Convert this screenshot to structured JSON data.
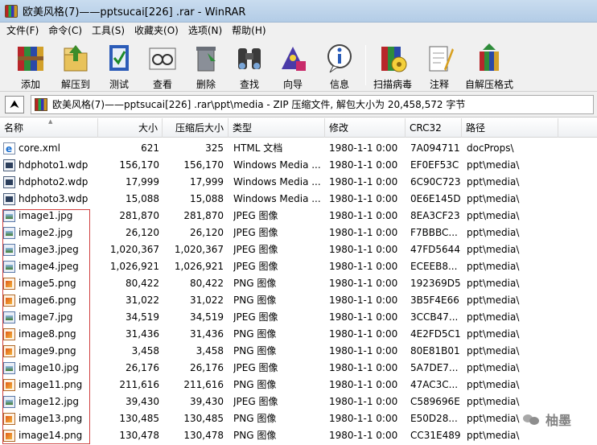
{
  "window": {
    "title": "欧美风格(7)——pptsucai[226] .rar - WinRAR"
  },
  "menu": [
    "文件(F)",
    "命令(C)",
    "工具(S)",
    "收藏夹(O)",
    "选项(N)",
    "帮助(H)"
  ],
  "toolbar": {
    "buttons": [
      {
        "label": "添加",
        "icon": "add-archive-icon"
      },
      {
        "label": "解压到",
        "icon": "extract-to-icon"
      },
      {
        "label": "测试",
        "icon": "test-icon"
      },
      {
        "label": "查看",
        "icon": "view-icon"
      },
      {
        "label": "删除",
        "icon": "delete-icon"
      },
      {
        "label": "查找",
        "icon": "find-binoculars-icon"
      },
      {
        "label": "向导",
        "icon": "wizard-icon"
      },
      {
        "label": "信息",
        "icon": "info-icon"
      },
      {
        "label": "扫描病毒",
        "icon": "virus-scan-icon"
      },
      {
        "label": "注释",
        "icon": "comment-icon"
      },
      {
        "label": "自解压格式",
        "icon": "sfx-icon"
      }
    ]
  },
  "address": {
    "path": "欧美风格(7)——pptsucai[226] .rar\\ppt\\media - ZIP 压缩文件, 解包大小为 20,458,572 字节"
  },
  "columns": [
    "名称",
    "大小",
    "压缩后大小",
    "类型",
    "修改",
    "CRC32",
    "路径"
  ],
  "files": [
    {
      "name": "core.xml",
      "size": "621",
      "packed": "325",
      "type": "HTML 文档",
      "modified": "1980-1-1 0:00",
      "crc": "7A094711",
      "path": "docProps\\",
      "icon": "xml"
    },
    {
      "name": "hdphoto1.wdp",
      "size": "156,170",
      "packed": "156,170",
      "type": "Windows Media ...",
      "modified": "1980-1-1 0:00",
      "crc": "EF0EF53C",
      "path": "ppt\\media\\",
      "icon": "wdp"
    },
    {
      "name": "hdphoto2.wdp",
      "size": "17,999",
      "packed": "17,999",
      "type": "Windows Media ...",
      "modified": "1980-1-1 0:00",
      "crc": "6C90C723",
      "path": "ppt\\media\\",
      "icon": "wdp"
    },
    {
      "name": "hdphoto3.wdp",
      "size": "15,088",
      "packed": "15,088",
      "type": "Windows Media ...",
      "modified": "1980-1-1 0:00",
      "crc": "0E6E145D",
      "path": "ppt\\media\\",
      "icon": "wdp"
    },
    {
      "name": "image1.jpg",
      "size": "281,870",
      "packed": "281,870",
      "type": "JPEG 图像",
      "modified": "1980-1-1 0:00",
      "crc": "8EA3CF23",
      "path": "ppt\\media\\",
      "icon": "jpg"
    },
    {
      "name": "image2.jpg",
      "size": "26,120",
      "packed": "26,120",
      "type": "JPEG 图像",
      "modified": "1980-1-1 0:00",
      "crc": "F7BBBC...",
      "path": "ppt\\media\\",
      "icon": "jpg"
    },
    {
      "name": "image3.jpeg",
      "size": "1,020,367",
      "packed": "1,020,367",
      "type": "JPEG 图像",
      "modified": "1980-1-1 0:00",
      "crc": "47FD5644",
      "path": "ppt\\media\\",
      "icon": "jpg"
    },
    {
      "name": "image4.jpeg",
      "size": "1,026,921",
      "packed": "1,026,921",
      "type": "JPEG 图像",
      "modified": "1980-1-1 0:00",
      "crc": "ECEEB8...",
      "path": "ppt\\media\\",
      "icon": "jpg"
    },
    {
      "name": "image5.png",
      "size": "80,422",
      "packed": "80,422",
      "type": "PNG 图像",
      "modified": "1980-1-1 0:00",
      "crc": "192369D5",
      "path": "ppt\\media\\",
      "icon": "png"
    },
    {
      "name": "image6.png",
      "size": "31,022",
      "packed": "31,022",
      "type": "PNG 图像",
      "modified": "1980-1-1 0:00",
      "crc": "3B5F4E66",
      "path": "ppt\\media\\",
      "icon": "png"
    },
    {
      "name": "image7.jpg",
      "size": "34,519",
      "packed": "34,519",
      "type": "JPEG 图像",
      "modified": "1980-1-1 0:00",
      "crc": "3CCB47...",
      "path": "ppt\\media\\",
      "icon": "jpg"
    },
    {
      "name": "image8.png",
      "size": "31,436",
      "packed": "31,436",
      "type": "PNG 图像",
      "modified": "1980-1-1 0:00",
      "crc": "4E2FD5C1",
      "path": "ppt\\media\\",
      "icon": "png"
    },
    {
      "name": "image9.png",
      "size": "3,458",
      "packed": "3,458",
      "type": "PNG 图像",
      "modified": "1980-1-1 0:00",
      "crc": "80E81B01",
      "path": "ppt\\media\\",
      "icon": "png"
    },
    {
      "name": "image10.jpg",
      "size": "26,176",
      "packed": "26,176",
      "type": "JPEG 图像",
      "modified": "1980-1-1 0:00",
      "crc": "5A7DE7...",
      "path": "ppt\\media\\",
      "icon": "jpg"
    },
    {
      "name": "image11.png",
      "size": "211,616",
      "packed": "211,616",
      "type": "PNG 图像",
      "modified": "1980-1-1 0:00",
      "crc": "47AC3C...",
      "path": "ppt\\media\\",
      "icon": "png"
    },
    {
      "name": "image12.jpg",
      "size": "39,430",
      "packed": "39,430",
      "type": "JPEG 图像",
      "modified": "1980-1-1 0:00",
      "crc": "C589696E",
      "path": "ppt\\media\\",
      "icon": "jpg"
    },
    {
      "name": "image13.png",
      "size": "130,485",
      "packed": "130,485",
      "type": "PNG 图像",
      "modified": "1980-1-1 0:00",
      "crc": "E50D28...",
      "path": "ppt\\media\\",
      "icon": "png"
    },
    {
      "name": "image14.png",
      "size": "130,478",
      "packed": "130,478",
      "type": "PNG 图像",
      "modified": "1980-1-1 0:00",
      "crc": "CC31E489",
      "path": "ppt\\media\\",
      "icon": "png"
    }
  ],
  "watermark": {
    "text": "柚墨",
    "icon": "wechat-icon"
  }
}
